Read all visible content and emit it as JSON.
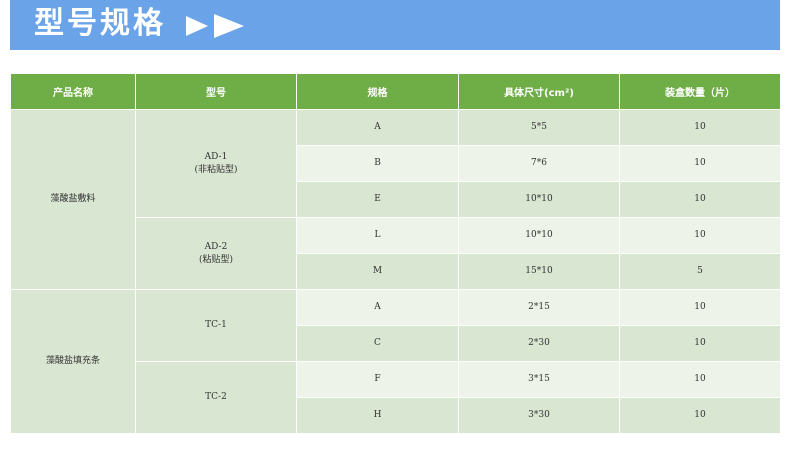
{
  "banner": {
    "title": "型号规格",
    "arrow_color": "#ffffff",
    "background": "#6aa3e8"
  },
  "table": {
    "header_color": "#6fad46",
    "headers": [
      "产品名称",
      "型号",
      "规格",
      "具体尺寸(cm²)",
      "装盒数量（片）"
    ],
    "products": [
      "藻酸盐敷料",
      "藻酸盐填充条"
    ],
    "models": [
      {
        "line1": "AD-1",
        "line2": "(非粘贴型)"
      },
      {
        "line1": "AD-2",
        "line2": "(粘贴型)"
      },
      {
        "line1": "TC-1",
        "line2": ""
      },
      {
        "line1": "TC-2",
        "line2": ""
      }
    ],
    "rows": [
      {
        "spec": "A",
        "size": "5*5",
        "qty": "10"
      },
      {
        "spec": "B",
        "size": "7*6",
        "qty": "10"
      },
      {
        "spec": "E",
        "size": "10*10",
        "qty": "10"
      },
      {
        "spec": "L",
        "size": "10*10",
        "qty": "10"
      },
      {
        "spec": "M",
        "size": "15*10",
        "qty": "5"
      },
      {
        "spec": "A",
        "size": "2*15",
        "qty": "10"
      },
      {
        "spec": "C",
        "size": "2*30",
        "qty": "10"
      },
      {
        "spec": "F",
        "size": "3*15",
        "qty": "10"
      },
      {
        "spec": "H",
        "size": "3*30",
        "qty": "10"
      }
    ]
  }
}
